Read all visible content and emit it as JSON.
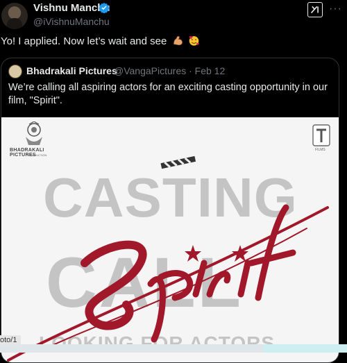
{
  "post": {
    "display_name": "Vishnu Manchu",
    "handle": "@iVishnuManchu",
    "text": "Yo! I applied. Now let’s wait and see",
    "emojis": [
      "flexed-biceps",
      "smiling-face-with-hearts"
    ]
  },
  "quote": {
    "display_name": "Bhadrakali Pictures",
    "handle_date": "@VangaPictures · Feb 12",
    "text": "We’re calling all aspiring actors for an exciting casting opportunity in our film, \"Spirit\".",
    "poster": {
      "left_logo_name": "BHADRAKALI PICTURES",
      "left_logo_sub": "PRODUCTION",
      "right_logo_sub": "FILMS",
      "headline_top": "CASTING",
      "headline_bottom": "CALL",
      "title_script": "Spirit",
      "footer_line": "LOOKING FOR ACTORS",
      "accent_color": "#a0182a"
    }
  },
  "photo_label": "oto/1"
}
